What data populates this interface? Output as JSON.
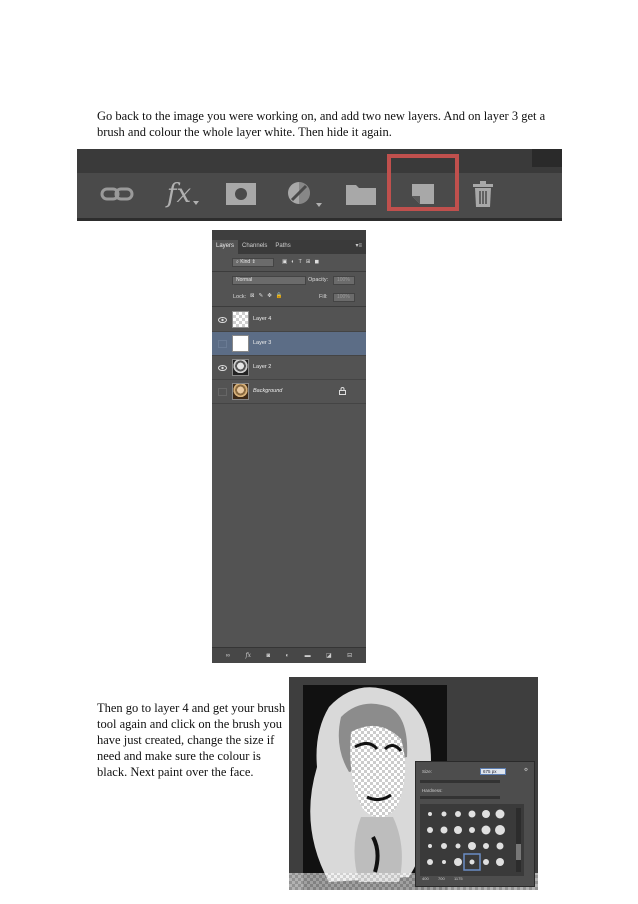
{
  "instructions": {
    "step1_text": "Go back to the image you were working on, and add two new layers. And on layer 3 get a brush and colour the whole layer white. Then hide it again.",
    "step2_text": "Then go to layer 4 and get your brush tool again and click on the brush you have just created, change the size if need and make sure the colour is black. Next paint over the face."
  },
  "toolbar": {
    "icons": [
      "link-icon",
      "fx-icon",
      "mask-icon",
      "adjustment-icon",
      "folder-icon",
      "new-layer-icon",
      "trash-icon"
    ],
    "fx_label": "fx",
    "highlighted_icon": "new-layer-icon",
    "highlight_color": "#c0504d"
  },
  "layers_panel": {
    "tabs": [
      "Layers",
      "Channels",
      "Paths"
    ],
    "active_tab": "Layers",
    "filter_label": "Kind",
    "blend_mode": "Normal",
    "opacity_label": "Opacity:",
    "opacity_value": "100%",
    "lock_label": "Lock:",
    "fill_label": "Fill:",
    "fill_value": "100%",
    "layers": [
      {
        "name": "Layer 4",
        "visible": true,
        "selected": false,
        "thumb": "transparent"
      },
      {
        "name": "Layer 3",
        "visible": false,
        "selected": true,
        "thumb": "white"
      },
      {
        "name": "Layer 2",
        "visible": true,
        "selected": false,
        "thumb": "photo-bw"
      },
      {
        "name": "Background",
        "visible": false,
        "selected": false,
        "thumb": "photo-color",
        "locked": true
      }
    ],
    "bottom_icons": [
      "link-icon",
      "fx-icon",
      "mask-icon",
      "adjustment-icon",
      "folder-icon",
      "new-layer-icon",
      "trash-icon"
    ],
    "bottom_fx_label": "fx",
    "selected_color": "#5c6d86"
  },
  "brush_panel": {
    "size_label": "Size:",
    "size_value": "675 px",
    "hardness_label": "Hardness:",
    "preset_sizes": [
      "400",
      "700",
      "1175"
    ]
  }
}
